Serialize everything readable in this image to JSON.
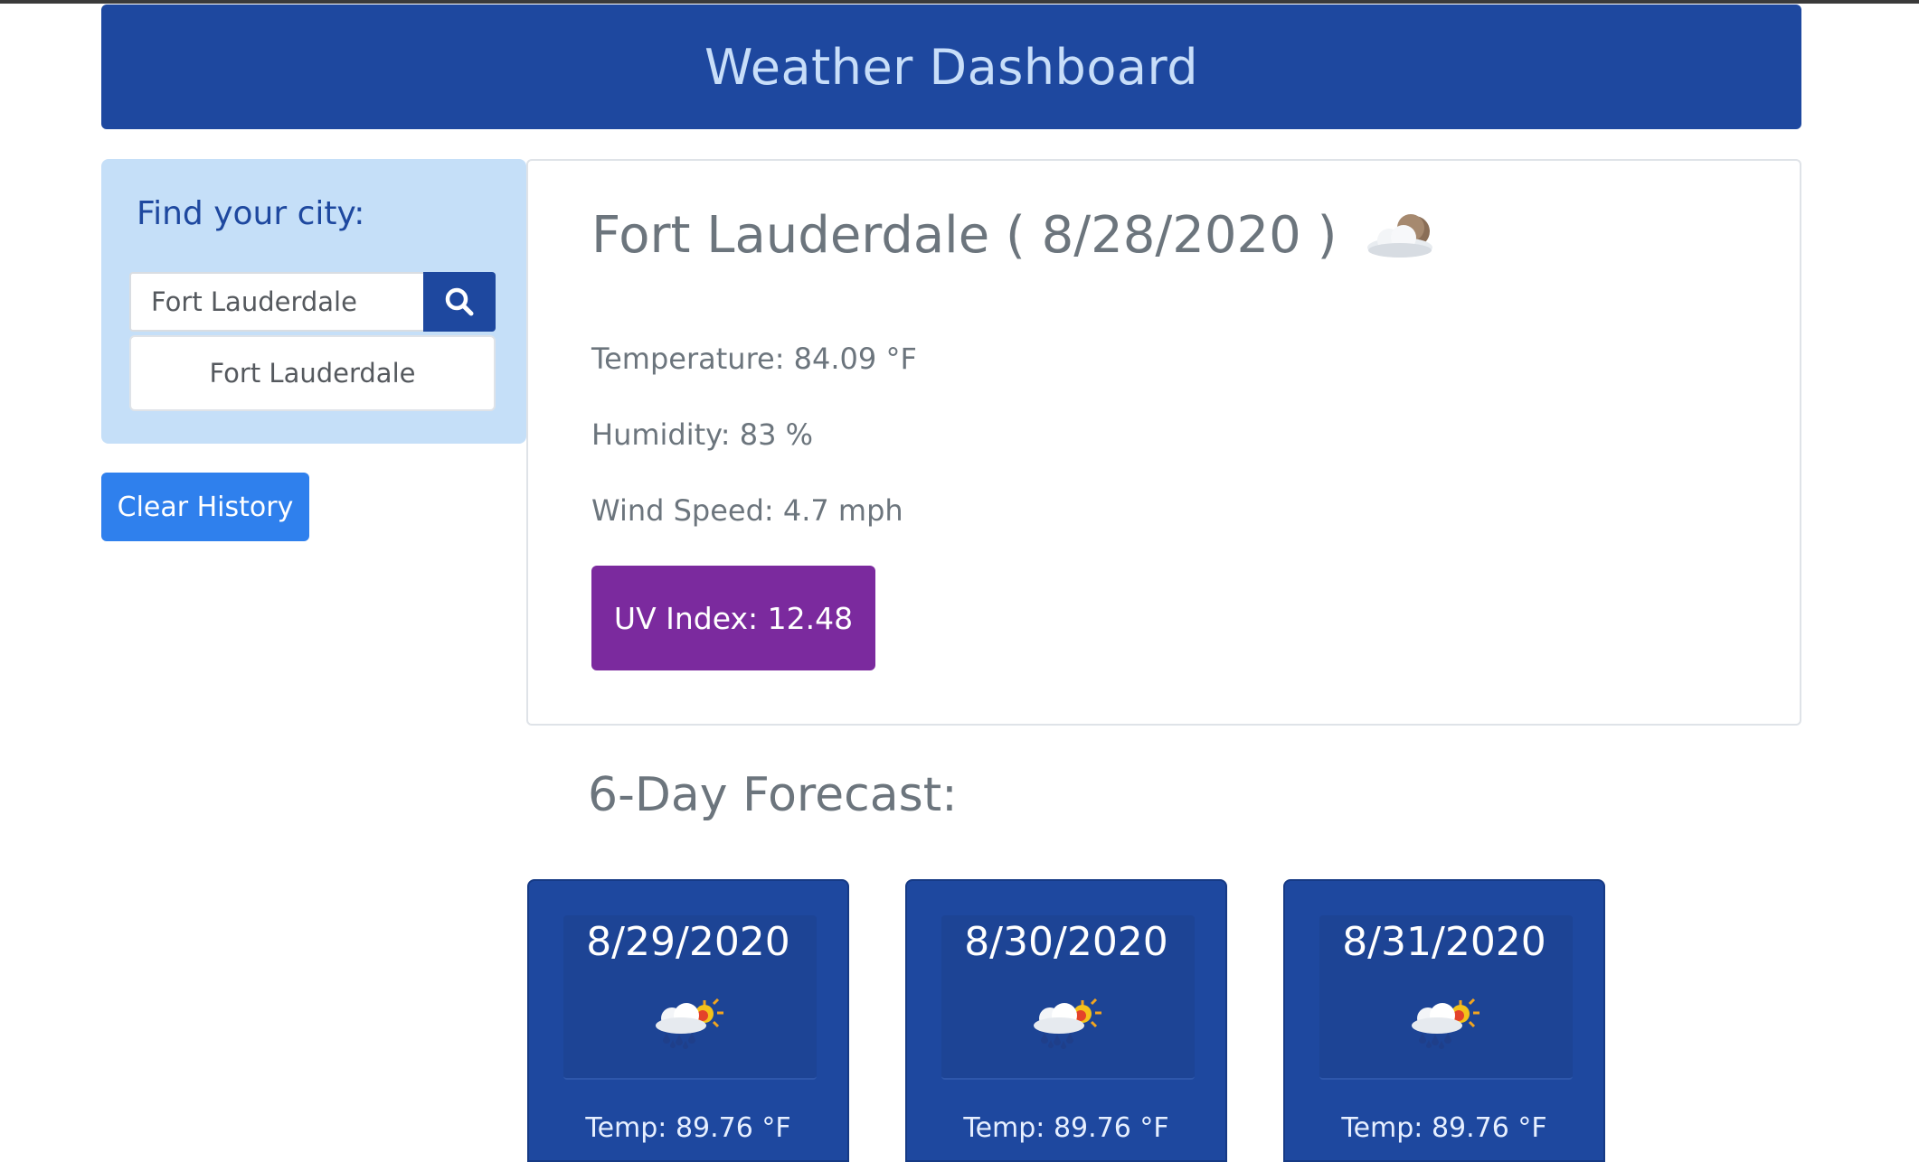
{
  "header": {
    "title": "Weather Dashboard"
  },
  "sidebar": {
    "find_label": "Find your city:",
    "search_value": "Fort Lauderdale",
    "search_icon": "search-icon",
    "history": [
      "Fort Lauderdale"
    ],
    "clear_label": "Clear History"
  },
  "current": {
    "title": "Fort Lauderdale ( 8/28/2020 )",
    "icon": "partly-cloudy-night-icon",
    "temperature": "Temperature: 84.09 °F",
    "humidity": "Humidity: 83 %",
    "wind": "Wind Speed: 4.7 mph",
    "uv": "UV Index:  12.48",
    "uv_color": "#7b2a9e"
  },
  "forecast": {
    "title": "6-Day Forecast:",
    "days": [
      {
        "date": "8/29/2020",
        "icon": "rain-sun-icon",
        "temp": "Temp: 89.76 °F"
      },
      {
        "date": "8/30/2020",
        "icon": "rain-sun-icon",
        "temp": "Temp: 89.76 °F"
      },
      {
        "date": "8/31/2020",
        "icon": "rain-sun-icon",
        "temp": "Temp: 89.76 °F"
      }
    ]
  },
  "colors": {
    "header_bg": "#1e489f",
    "header_text": "#c8def9",
    "sidebar_bg": "#c5dff8",
    "clear_btn": "#2f80ed",
    "forecast_card": "#1e489f"
  }
}
